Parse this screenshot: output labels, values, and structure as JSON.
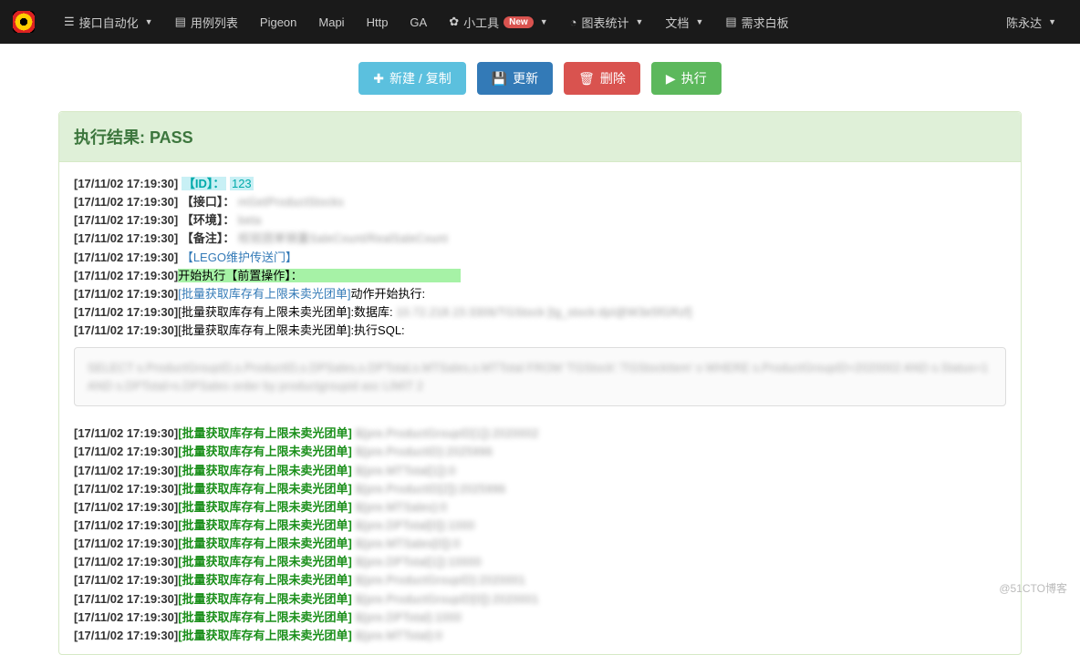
{
  "nav": {
    "items": [
      {
        "label": "接口自动化",
        "icon": "☰",
        "caret": true
      },
      {
        "label": "用例列表",
        "icon": "▤",
        "caret": false
      },
      {
        "label": "Pigeon",
        "icon": "",
        "caret": false
      },
      {
        "label": "Mapi",
        "icon": "",
        "caret": false
      },
      {
        "label": "Http",
        "icon": "",
        "caret": false
      },
      {
        "label": "GA",
        "icon": "",
        "caret": false
      },
      {
        "label": "小工具",
        "icon": "✿",
        "caret": true,
        "badge": "New"
      },
      {
        "label": "图表统计",
        "icon": "◔",
        "caret": true
      },
      {
        "label": "文档",
        "icon": "",
        "caret": true
      },
      {
        "label": "需求白板",
        "icon": "▤",
        "caret": false
      }
    ],
    "user": "陈永达"
  },
  "toolbar": {
    "new": "新建 / 复制",
    "update": "更新",
    "delete": "删除",
    "run": "执行"
  },
  "result": {
    "header": "执行结果: PASS"
  },
  "log": {
    "ts": "[17/11/02 17:19:30]",
    "id_tag": "【ID】：",
    "id_val": "123",
    "api_tag": "【接口】：",
    "api_val": "mGetProductStocks",
    "env_tag": "【环境】：",
    "env_val": "beta",
    "note_tag": "【备注】：",
    "note_val": "校验团单销量SaleCount/RealSaleCount",
    "portal": "【LEGO维护传送门】",
    "start": "开始执行【前置操作】：",
    "batch_prefix": "[批量获取库存有上限未卖光团单]",
    "action_start": "动作开始执行:",
    "db_label": ":数据库:",
    "db_val": "10.72.218.15:3306/TGStock [tg_stock:dpI@W3e5fGRzf]",
    "sql_label": ":执行SQL:",
    "sql_body": "SELECT s.ProductGroupID,s.ProductID,s.DPSales,s.DPTotal,s.MTSales,s.MTTotal FROM 'TGStock'.'TGStockItem' s WHERE s.ProductGroupID=2020002 AND s.Status=1 AND s.DPTotal>s.DPSales order by productgroupid asc LIMIT 2",
    "outputs": [
      "${pre.ProductGroupID[1]}:2020002",
      "${pre.ProductID}:2025996",
      "${pre.MTTotal[1]}:0",
      "${pre.ProductID[2]}:2025996",
      "${pre.MTSales}:0",
      "${pre.DPTotal[0]}:1000",
      "${pre.MTSales[0]}:0",
      "${pre.DPTotal[1]}:10000",
      "${pre.ProductGroupID}:2020001",
      "${pre.ProductGroupID[0]}:2020001",
      "${pre.DPTotal}:1000",
      "${pre.MTTotal}:0"
    ]
  },
  "watermark": "@51CTO博客"
}
